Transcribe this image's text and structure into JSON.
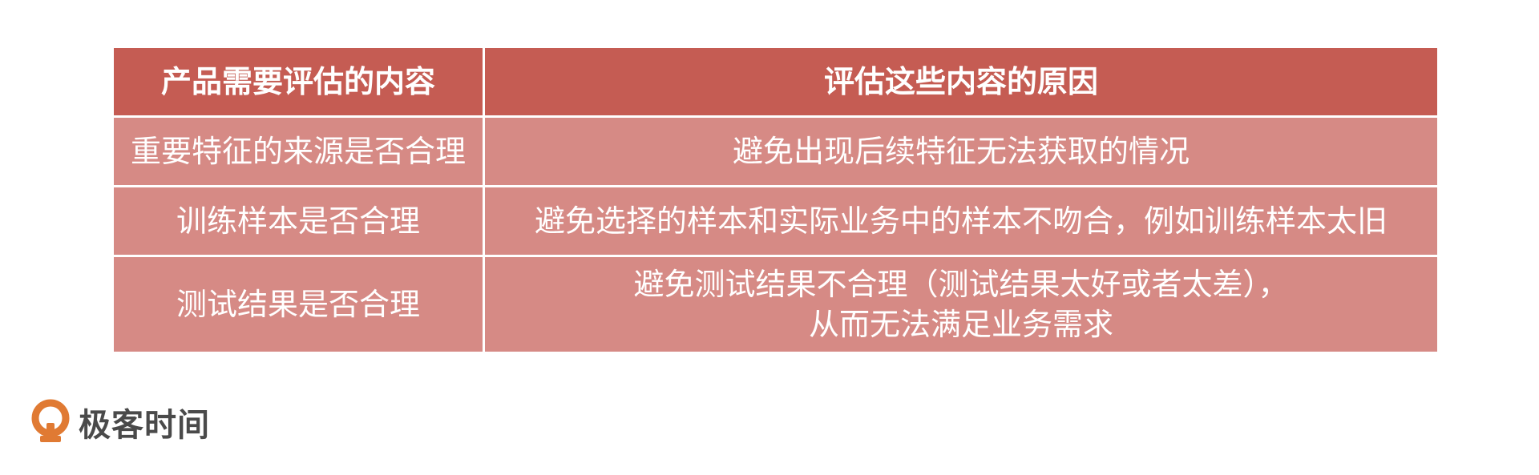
{
  "table": {
    "headers": [
      "产品需要评估的内容",
      "评估这些内容的原因"
    ],
    "rows": [
      {
        "item": "重要特征的来源是否合理",
        "reason": [
          "避免出现后续特征无法获取的情况"
        ]
      },
      {
        "item": "训练样本是否合理",
        "reason": [
          "避免选择的样本和实际业务中的样本不吻合，例如训练样本太旧"
        ]
      },
      {
        "item": "测试结果是否合理",
        "reason": [
          "避免测试结果不合理（测试结果太好或者太差），",
          "从而无法满足业务需求"
        ]
      }
    ]
  },
  "brand": {
    "name": "极客时间",
    "logo_icon": "geektime-logo-icon",
    "colors": {
      "header_bg": "#c55c53",
      "row_bg": "#d68a85",
      "logo_accent": "#e07a33"
    }
  }
}
